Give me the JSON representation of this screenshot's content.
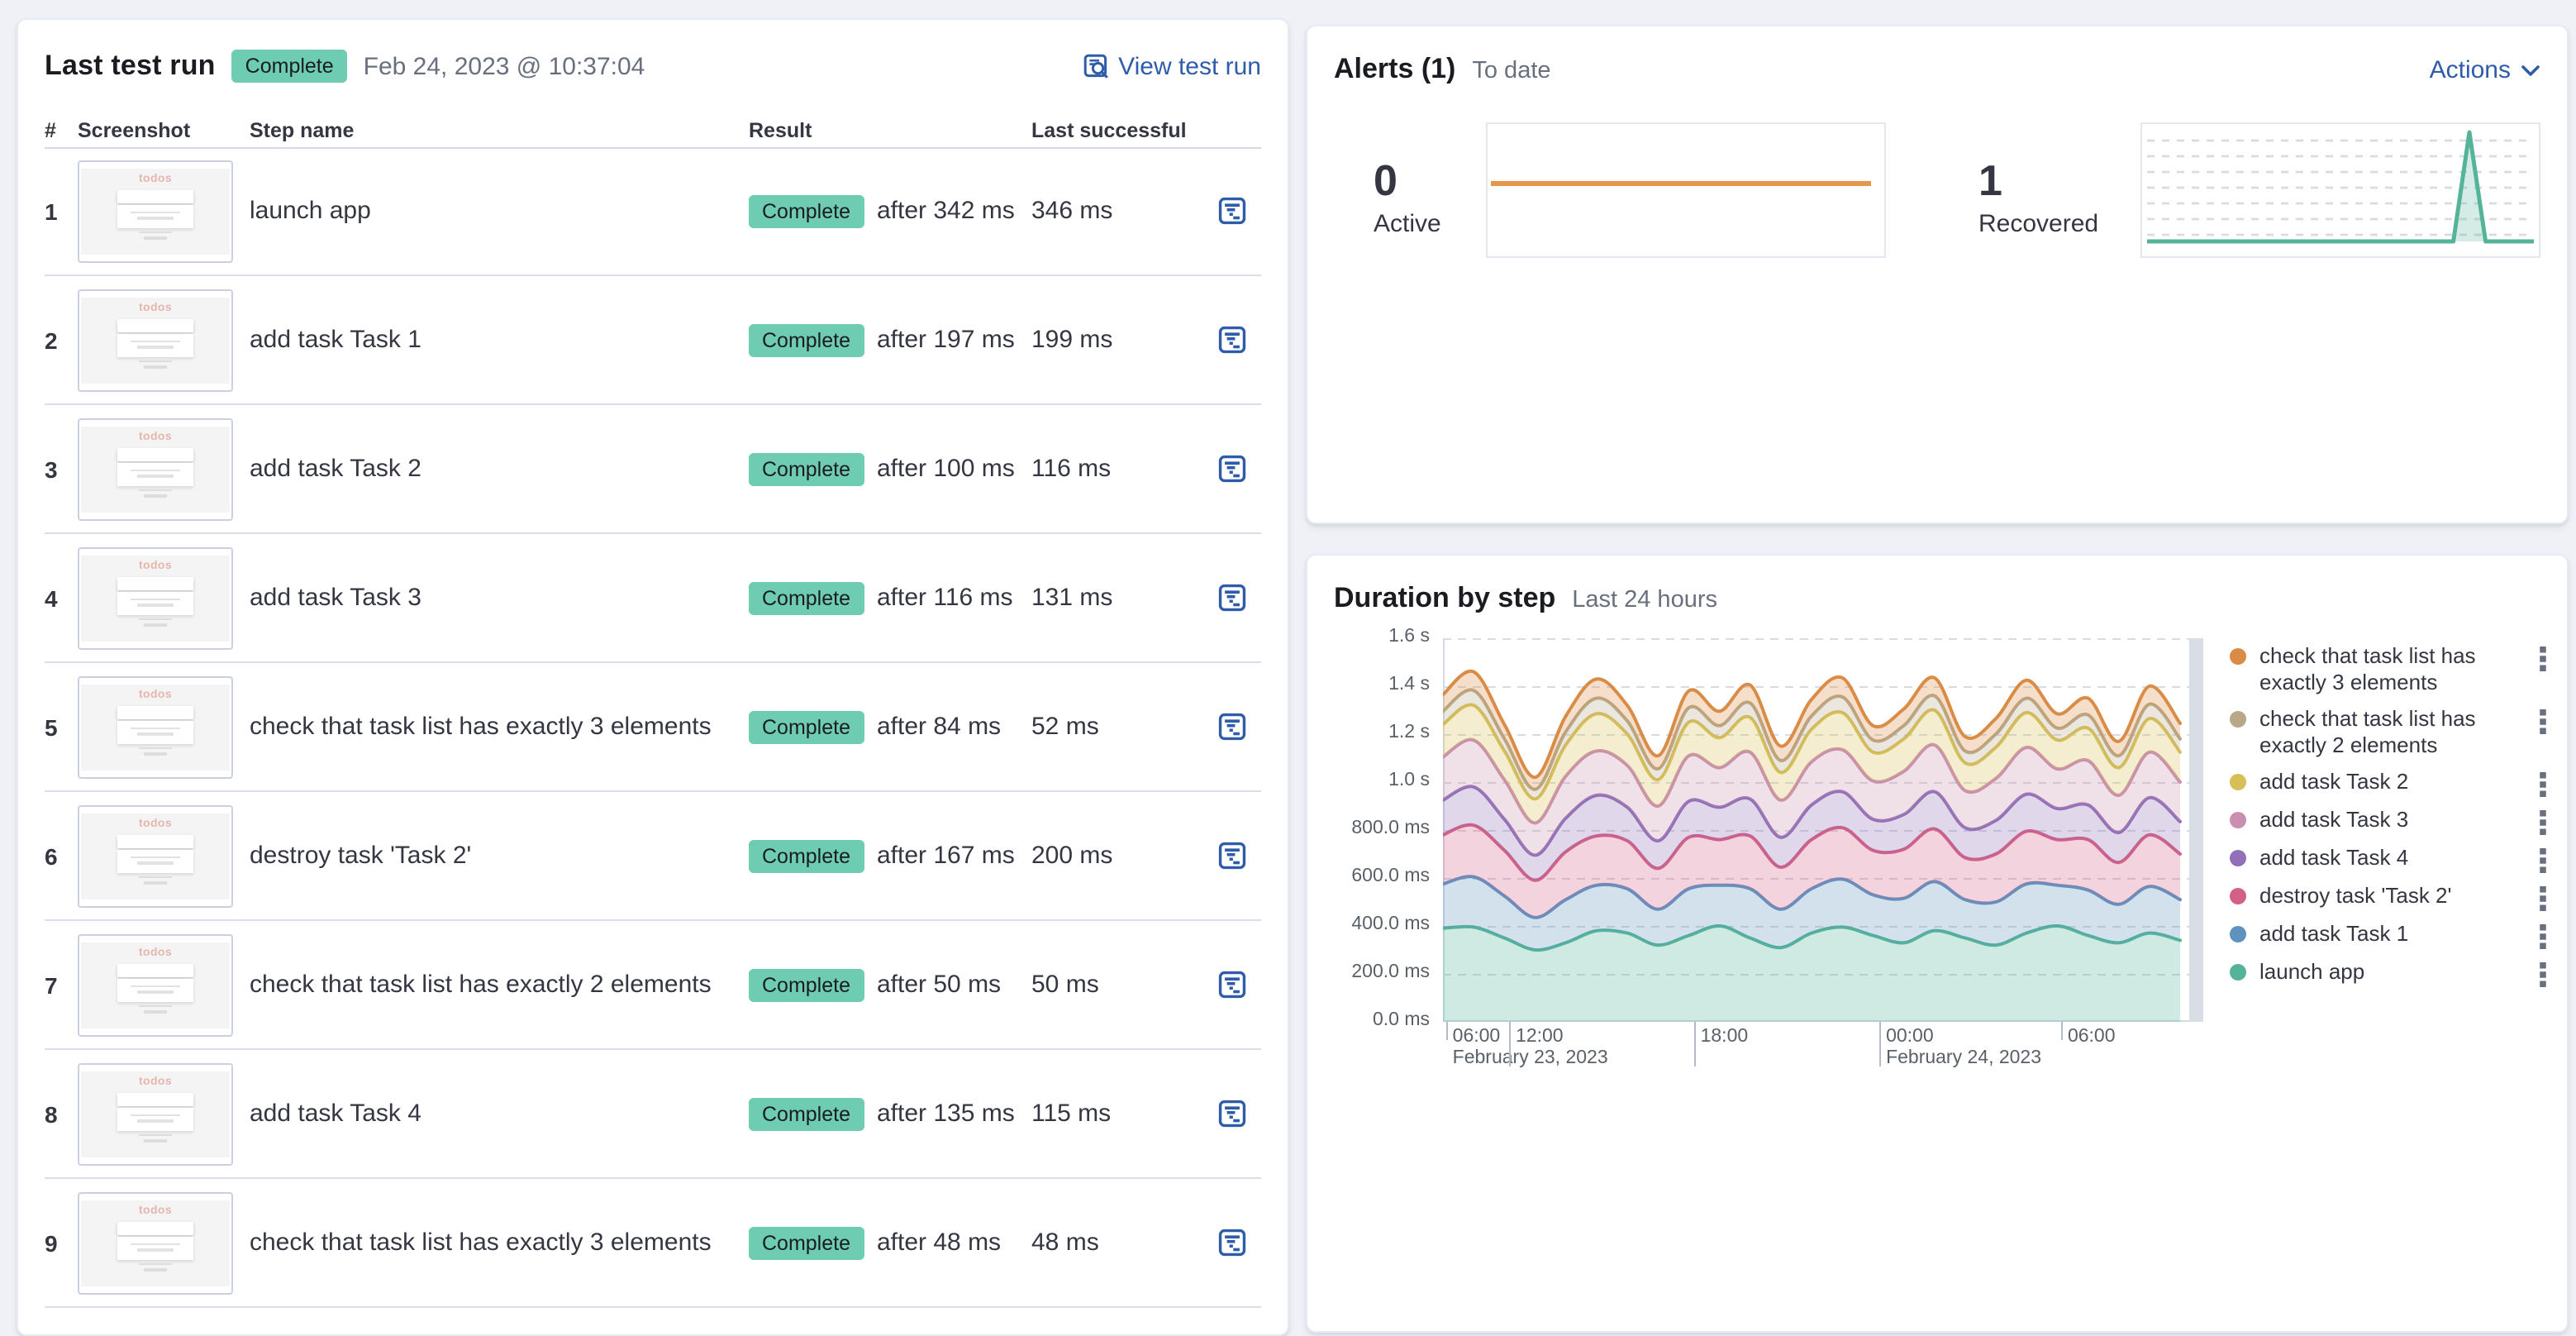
{
  "colors": {
    "accent_link": "#2e5cab",
    "badge_success_bg": "#6dccb1",
    "page_bg": "#eff1f6",
    "divider": "#d9dee8",
    "text_primary": "#343741",
    "text_subdued": "#69707d",
    "spark_active_line": "#e8954c",
    "spark_recovered_line": "#54b399"
  },
  "last_test_run": {
    "title": "Last test run",
    "status_badge": "Complete",
    "timestamp": "Feb 24, 2023 @ 10:37:04",
    "view_link": "View test run",
    "thumbnail_text": "todos",
    "columns": [
      "#",
      "Screenshot",
      "Step name",
      "Result",
      "Last successful"
    ],
    "rows": [
      {
        "num": "1",
        "step": "launch app",
        "badge": "Complete",
        "after": "after 342 ms",
        "last": "346 ms"
      },
      {
        "num": "2",
        "step": "add task Task 1",
        "badge": "Complete",
        "after": "after 197 ms",
        "last": "199 ms"
      },
      {
        "num": "3",
        "step": "add task Task 2",
        "badge": "Complete",
        "after": "after 100 ms",
        "last": "116 ms"
      },
      {
        "num": "4",
        "step": "add task Task 3",
        "badge": "Complete",
        "after": "after 116 ms",
        "last": "131 ms"
      },
      {
        "num": "5",
        "step": "check that task list has exactly 3 elements",
        "badge": "Complete",
        "after": "after 84 ms",
        "last": "52 ms"
      },
      {
        "num": "6",
        "step": "destroy task 'Task 2'",
        "badge": "Complete",
        "after": "after 167 ms",
        "last": "200 ms"
      },
      {
        "num": "7",
        "step": "check that task list has exactly 2 elements",
        "badge": "Complete",
        "after": "after 50 ms",
        "last": "50 ms"
      },
      {
        "num": "8",
        "step": "add task Task 4",
        "badge": "Complete",
        "after": "after 135 ms",
        "last": "115 ms"
      },
      {
        "num": "9",
        "step": "check that task list has exactly 3 elements",
        "badge": "Complete",
        "after": "after 48 ms",
        "last": "48 ms"
      }
    ]
  },
  "alerts": {
    "title": "Alerts (1)",
    "subtitle": "To date",
    "actions_label": "Actions",
    "active": {
      "count": "0",
      "label": "Active"
    },
    "recovered": {
      "count": "1",
      "label": "Recovered"
    }
  },
  "duration": {
    "title": "Duration by step",
    "subtitle": "Last 24 hours"
  },
  "chart_data": [
    {
      "type": "area",
      "stacked": true,
      "title": "Duration by step",
      "subtitle": "Last 24 hours",
      "legend_position": "right",
      "grid": "horizontal-dashed",
      "ylim_ms": [
        0,
        1600
      ],
      "y_ticks": [
        "1.6 s",
        "1.4 s",
        "1.2 s",
        "1.0 s",
        "800.0 ms",
        "600.0 ms",
        "400.0 ms",
        "200.0 ms",
        "0.0 ms"
      ],
      "x_ticks": [
        {
          "label": "06:00",
          "frac": 0.004,
          "tall": false,
          "date": "February 23, 2023"
        },
        {
          "label": "12:00",
          "frac": 0.087,
          "tall": true,
          "date": ""
        },
        {
          "label": "18:00",
          "frac": 0.33,
          "tall": true,
          "date": ""
        },
        {
          "label": "00:00",
          "frac": 0.574,
          "tall": true,
          "date": "February 24, 2023"
        },
        {
          "label": "06:00",
          "frac": 0.813,
          "tall": false,
          "date": ""
        }
      ],
      "series": [
        {
          "name": "launch app",
          "color": "#54B399",
          "values": [
            390,
            395,
            350,
            300,
            330,
            380,
            370,
            320,
            360,
            400,
            350,
            310,
            370,
            395,
            360,
            330,
            380,
            350,
            320,
            370,
            400,
            360,
            330,
            370,
            340
          ]
        },
        {
          "name": "add task Task 1",
          "color": "#6092C0",
          "values": [
            185,
            210,
            175,
            135,
            180,
            190,
            185,
            150,
            195,
            170,
            205,
            160,
            185,
            200,
            170,
            185,
            205,
            160,
            180,
            205,
            170,
            190,
            160,
            195,
            170
          ]
        },
        {
          "name": "destroy task 'Task 2'",
          "color": "#D36086",
          "values": [
            205,
            215,
            190,
            155,
            200,
            205,
            200,
            170,
            215,
            190,
            220,
            175,
            205,
            215,
            185,
            205,
            220,
            175,
            200,
            220,
            190,
            210,
            175,
            215,
            190
          ]
        },
        {
          "name": "add task Task 4",
          "color": "#9170B8",
          "values": [
            145,
            160,
            130,
            105,
            140,
            170,
            140,
            115,
            150,
            135,
            155,
            125,
            145,
            150,
            130,
            145,
            155,
            125,
            140,
            155,
            130,
            145,
            125,
            155,
            135
          ]
        },
        {
          "name": "add task Task 3",
          "color": "#CA8EAE",
          "values": [
            180,
            195,
            165,
            135,
            175,
            185,
            175,
            145,
            190,
            165,
            195,
            155,
            180,
            175,
            160,
            180,
            195,
            155,
            175,
            195,
            165,
            185,
            155,
            190,
            165
          ]
        },
        {
          "name": "add task Task 2",
          "color": "#D6BF57",
          "values": [
            135,
            145,
            120,
            100,
            130,
            155,
            130,
            110,
            140,
            125,
            145,
            115,
            135,
            155,
            120,
            135,
            145,
            115,
            130,
            145,
            120,
            135,
            115,
            140,
            125
          ]
        },
        {
          "name": "check that task list has exactly 2 elements",
          "color": "#B9A888",
          "values": [
            55,
            62,
            50,
            40,
            55,
            65,
            55,
            45,
            60,
            50,
            60,
            50,
            55,
            65,
            50,
            55,
            60,
            50,
            55,
            60,
            50,
            55,
            50,
            60,
            55
          ]
        },
        {
          "name": "check that task list has exactly 3 elements",
          "color": "#DA8B45",
          "values": [
            70,
            78,
            60,
            50,
            65,
            80,
            65,
            55,
            70,
            60,
            75,
            60,
            70,
            80,
            60,
            70,
            75,
            60,
            65,
            75,
            60,
            70,
            60,
            75,
            65
          ]
        }
      ]
    },
    {
      "type": "line",
      "name": "Active alerts over time",
      "color": "#e8954c",
      "values": [
        0,
        0,
        0,
        0,
        0,
        0,
        0,
        0,
        0,
        0,
        0,
        0,
        0,
        0,
        0,
        0,
        0,
        0,
        0,
        0,
        0,
        0,
        0,
        0,
        0
      ]
    },
    {
      "type": "area",
      "name": "Recovered alerts over time",
      "color": "#54b399",
      "values": [
        0,
        0,
        0,
        0,
        0,
        0,
        0,
        0,
        0,
        0,
        0,
        0,
        0,
        0,
        0,
        0,
        0,
        0,
        0,
        0,
        1,
        0,
        0,
        0,
        0
      ]
    }
  ]
}
